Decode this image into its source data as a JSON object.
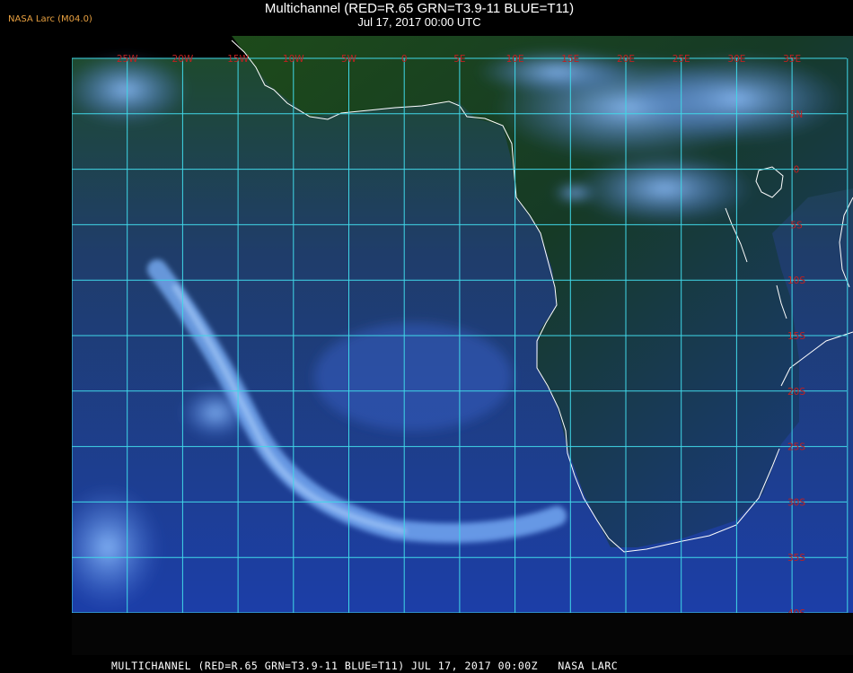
{
  "header": {
    "credit": "NASA Larc (M04.0)",
    "title": "Multichannel (RED=R.65 GRN=T3.9-11 BLUE=T11)",
    "datetime": "Jul 17, 2017 00:00 UTC"
  },
  "footer": {
    "caption": "MULTICHANNEL (RED=R.65 GRN=T3.9-11 BLUE=T11) JUL 17, 2017 00:00Z   NASA LARC"
  },
  "map": {
    "longitude_labels": [
      "25W",
      "20W",
      "15W",
      "10W",
      "5W",
      "0",
      "5E",
      "10E",
      "15E",
      "20E",
      "25E",
      "30E",
      "35E"
    ],
    "latitude_labels": [
      "5N",
      "0",
      "5S",
      "10S",
      "15S",
      "20S",
      "25S",
      "30S",
      "35S",
      "40S"
    ],
    "colors": {
      "grid": "#40d8e8",
      "label": "#c02020",
      "coast": "#ffffff",
      "ocean_clear": "#2040a0",
      "land": "#183818",
      "cloud": "#6aa8ff"
    }
  }
}
